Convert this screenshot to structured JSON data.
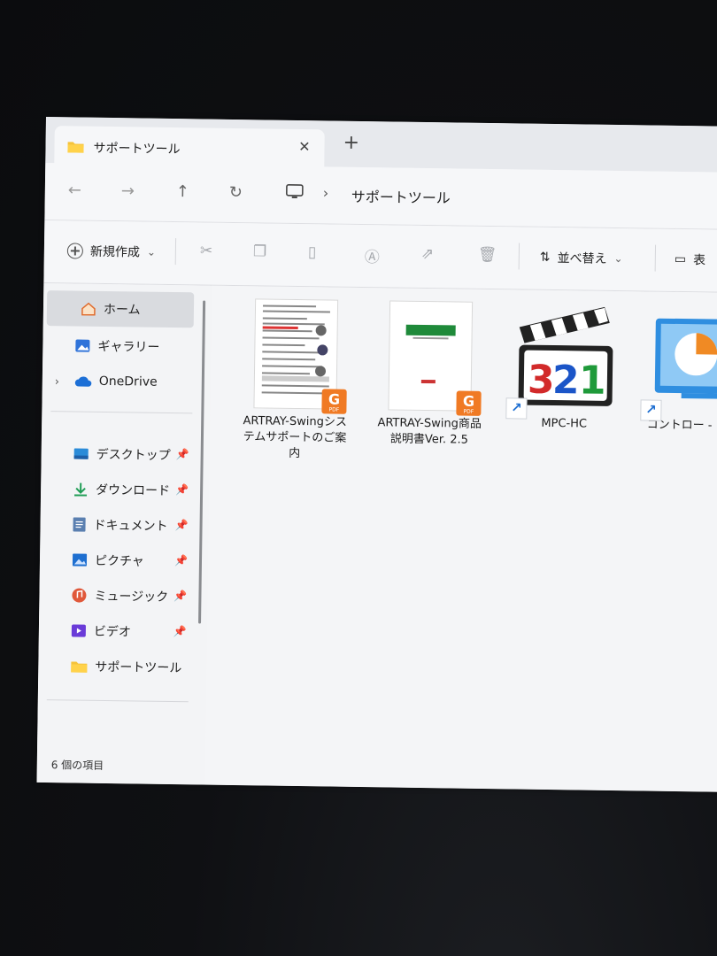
{
  "window": {
    "tab_title": "サポートツール",
    "close_glyph": "✕",
    "newtab_glyph": "+"
  },
  "navigation": {
    "back": "←",
    "forward": "→",
    "up": "↑",
    "refresh": "↻",
    "breadcrumb_sep": "›",
    "breadcrumb": "サポートツール"
  },
  "toolbar": {
    "new_label": "新規作成",
    "new_chevron": "⌄",
    "sort_label": "並べ替え",
    "sort_chevron": "⌄",
    "view_label": "表",
    "icons": [
      "cut-icon",
      "copy-icon",
      "paste-icon",
      "rename-icon",
      "share-icon",
      "delete-icon"
    ]
  },
  "sidebar": {
    "home": "ホーム",
    "gallery": "ギャラリー",
    "onedrive": "OneDrive",
    "quick": [
      {
        "label": "デスクトップ"
      },
      {
        "label": "ダウンロード"
      },
      {
        "label": "ドキュメント"
      },
      {
        "label": "ピクチャ"
      },
      {
        "label": "ミュージック"
      },
      {
        "label": "ビデオ"
      },
      {
        "label": "サポートツール"
      }
    ]
  },
  "files": [
    {
      "name": "ARTRAY-Swingシステムサポートのご案内",
      "badge": "G",
      "badge_sub": "PDF"
    },
    {
      "name": "ARTRAY-Swing商品説明書Ver. 2.5",
      "badge": "G",
      "badge_sub": "PDF"
    },
    {
      "name": "MPC-HC",
      "icon_text": "321"
    },
    {
      "name": "コントロー - ショー"
    }
  ],
  "status": {
    "count": "6 個の項目"
  },
  "colors": {
    "accent": "#1f6fd1",
    "pdf_badge": "#f07a24",
    "window_bg": "#f3f4f6"
  }
}
